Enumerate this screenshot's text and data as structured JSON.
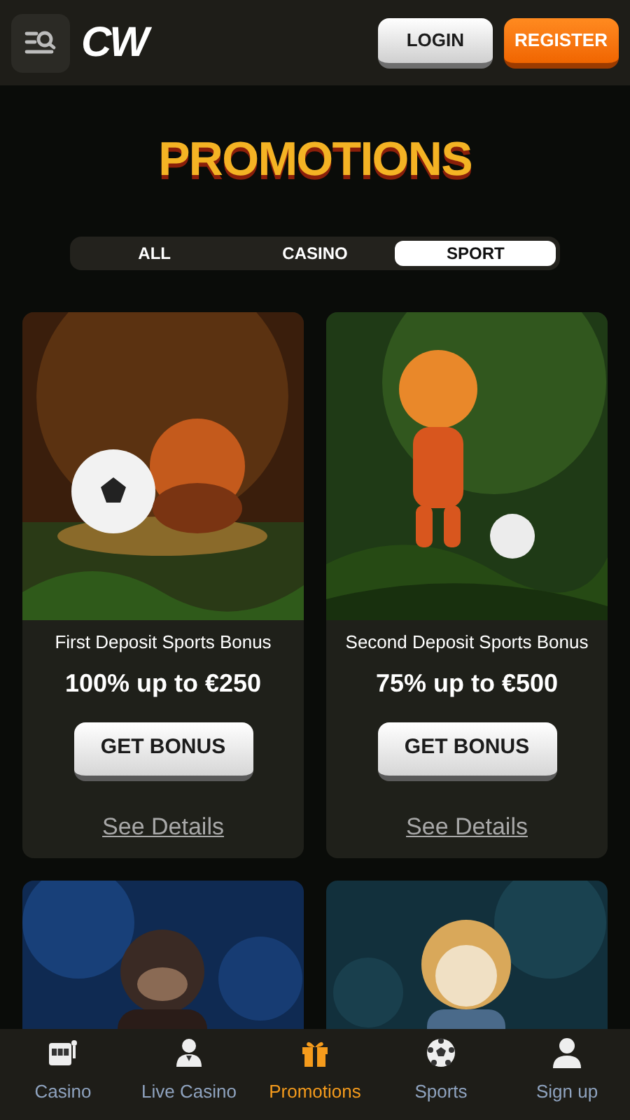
{
  "header": {
    "logo": "CW",
    "login": "LOGIN",
    "register": "REGISTER"
  },
  "title": "PROMOTIONS",
  "tabs": [
    {
      "label": "ALL",
      "selected": false
    },
    {
      "label": "CASINO",
      "selected": false
    },
    {
      "label": "SPORT",
      "selected": true
    }
  ],
  "promotions": [
    {
      "kind": "offer",
      "title": "First Deposit Sports Bonus",
      "offer": "100% up to €250",
      "button": "GET BONUS",
      "link": "See Details"
    },
    {
      "kind": "offer",
      "title": "Second Deposit Sports Bonus",
      "offer": "75% up to €500",
      "button": "GET BONUS",
      "link": "See Details"
    },
    {
      "kind": "picture"
    },
    {
      "kind": "picture"
    }
  ],
  "bottom_nav": [
    {
      "label": "Casino",
      "selected": false
    },
    {
      "label": "Live Casino",
      "selected": false
    },
    {
      "label": "Promotions",
      "selected": true
    },
    {
      "label": "Sports",
      "selected": false
    },
    {
      "label": "Sign up",
      "selected": false
    }
  ]
}
